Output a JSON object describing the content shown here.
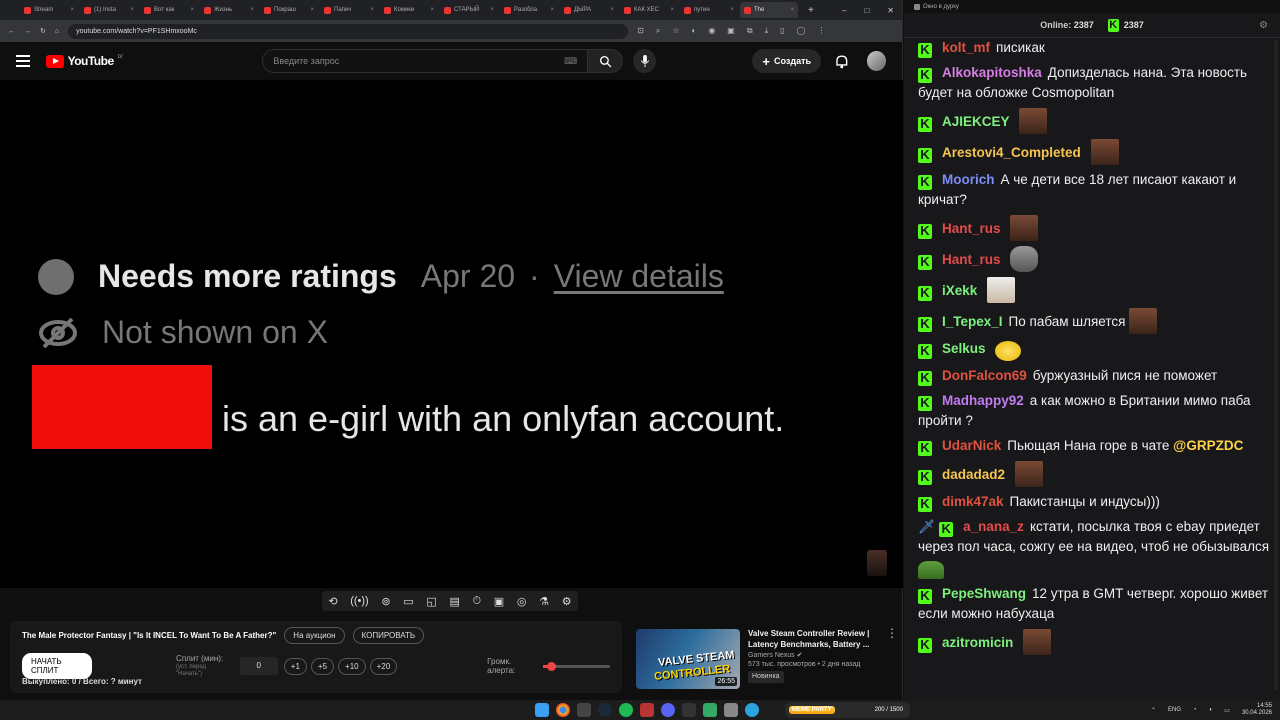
{
  "browser": {
    "tabs": [
      {
        "label": "Stream",
        "active": false
      },
      {
        "label": "(1) Insta",
        "active": false
      },
      {
        "label": "Вот как",
        "active": false
      },
      {
        "label": "Жизнь",
        "active": false
      },
      {
        "label": "Покраш",
        "active": false
      },
      {
        "label": "Папич",
        "active": false
      },
      {
        "label": "Комики",
        "active": false
      },
      {
        "label": "СТАРЫЙ",
        "active": false
      },
      {
        "label": "Разобла",
        "active": false
      },
      {
        "label": "ДЫРА",
        "active": false
      },
      {
        "label": "КАК ХЕС",
        "active": false
      },
      {
        "label": "путин",
        "active": false
      },
      {
        "label": "The",
        "active": true
      }
    ],
    "url": "youtube.com/watch?v=PF1SHmxooMc",
    "new_tab": "+",
    "win_min": "–",
    "win_max": "□",
    "win_close": "✕"
  },
  "youtube": {
    "logo_text": "YouTube",
    "logo_region": "LV",
    "search_placeholder": "Введите запрос",
    "create_label": "Создать",
    "create_plus": "+"
  },
  "video": {
    "rating_title": "Needs more ratings",
    "rating_date": "Apr 20",
    "rating_sep": "·",
    "rating_link": "View details",
    "not_shown": "Not shown on X",
    "egirl_text": "is an e-girl with an onlyfan account."
  },
  "toolbar_icons": [
    "⟲",
    "((•))",
    "⊚",
    "▭",
    "◱",
    "▤",
    "⏱",
    "▣",
    "◎",
    "⚗",
    "⚙"
  ],
  "panel": {
    "title": "The Male Protector Fantasy | \"Is It INCEL To Want To Be A Father?\"",
    "auction_label": "На аукцион",
    "copy_label": "КОПИРОВАТЬ",
    "start_label": "НАЧАТЬ СПЛИТ",
    "split_label": "Сплит (мин):",
    "split_sub": "(уст. перед \"Начать\")",
    "split_value": "0",
    "steps": [
      "+1",
      "+5",
      "+10",
      "+20"
    ],
    "alert_label": "Громк. алерта:",
    "alert_volume": 0.12,
    "paid_label": "Выкуплено: 0 / Всего: ? минут"
  },
  "recommendation": {
    "title": "Valve Steam Controller Review | Latency Benchmarks, Battery ...",
    "channel": "Gamers Nexus",
    "verified": "✔",
    "meta": "573 тыс. просмотров • 2 дня назад",
    "badge": "Новинка",
    "duration": "26:55",
    "thumb_line1": "VALVE STEAM",
    "thumb_line2": "CONTROLLER",
    "more": "⋮"
  },
  "chat": {
    "window_title": "Окно в дурку",
    "online_label": "Online:",
    "online_count": "2387",
    "viewer_count": "2387",
    "settings_icon": "⚙",
    "messages": [
      {
        "user": "kolt_mf",
        "color": "#e0513f",
        "text": "писикак",
        "emote": ""
      },
      {
        "user": "Alkokapitoshka",
        "color": "#d77ee6",
        "text": "Допизделась нана. Эта новость будет на обложке Cosmopolitan",
        "emote": ""
      },
      {
        "user": "AJIEKCEY",
        "color": "#7ef07e",
        "text": "",
        "emote": "face"
      },
      {
        "user": "Arestovi4_Completed",
        "color": "#f5c451",
        "text": "",
        "emote": "face"
      },
      {
        "user": "Moorich",
        "color": "#7c8cf8",
        "text": "А че дети все 18 лет писают какают и кричат?",
        "emote": ""
      },
      {
        "user": "Hant_rus",
        "color": "#e64a4a",
        "text": "",
        "emote": "face"
      },
      {
        "user": "Hant_rus",
        "color": "#e64a4a",
        "text": "",
        "emote": "rat"
      },
      {
        "user": "iXekk",
        "color": "#7ef07e",
        "text": "",
        "emote": "cat"
      },
      {
        "user": "I_Tepex_I",
        "color": "#7ef07e",
        "text": "По пабам шляется",
        "emote": "face"
      },
      {
        "user": "Selkus",
        "color": "#7ef07e",
        "text": "",
        "emote": "duck"
      },
      {
        "user": "DonFalcon69",
        "color": "#e0513f",
        "text": "буржуазный пися не поможет",
        "emote": ""
      },
      {
        "user": "Madhappy92",
        "color": "#c17cf0",
        "text": "а как можно в Британии мимо паба пройти ?",
        "emote": ""
      },
      {
        "user": "UdarNick",
        "color": "#e0513f",
        "text": "Пьющая Нана горе в чате",
        "mention": "@GRPZDC",
        "emote": ""
      },
      {
        "user": "dadadad2",
        "color": "#f5c451",
        "text": "",
        "emote": "face"
      },
      {
        "user": "dimk47ak",
        "color": "#e0513f",
        "text": "Пакистанцы и индусы)))",
        "emote": ""
      },
      {
        "user": "a_nana_z",
        "color": "#e64a4a",
        "text": "кстати, посылка твоя с ebay приедет через пол часа, сожгу ее на видео, чтоб не обызывался",
        "emote": "frog",
        "sword": true
      },
      {
        "user": "PepeShwang",
        "color": "#7ef07e",
        "text": "12 утра в GMT четверг. хорошо живет если можно набухаца",
        "emote": ""
      },
      {
        "user": "azitromicin",
        "color": "#7ef07e",
        "text": "",
        "emote": "face"
      }
    ]
  },
  "taskbar": {
    "stream_tag": "MEME PARTY",
    "stream_count": "200 / 1500",
    "lang": "ENG",
    "time": "14:55",
    "date": "30.04.2026"
  },
  "colors": {
    "brand_red": "#ff0000",
    "kick_green": "#53fc18",
    "censor_red": "#f20d0d"
  }
}
